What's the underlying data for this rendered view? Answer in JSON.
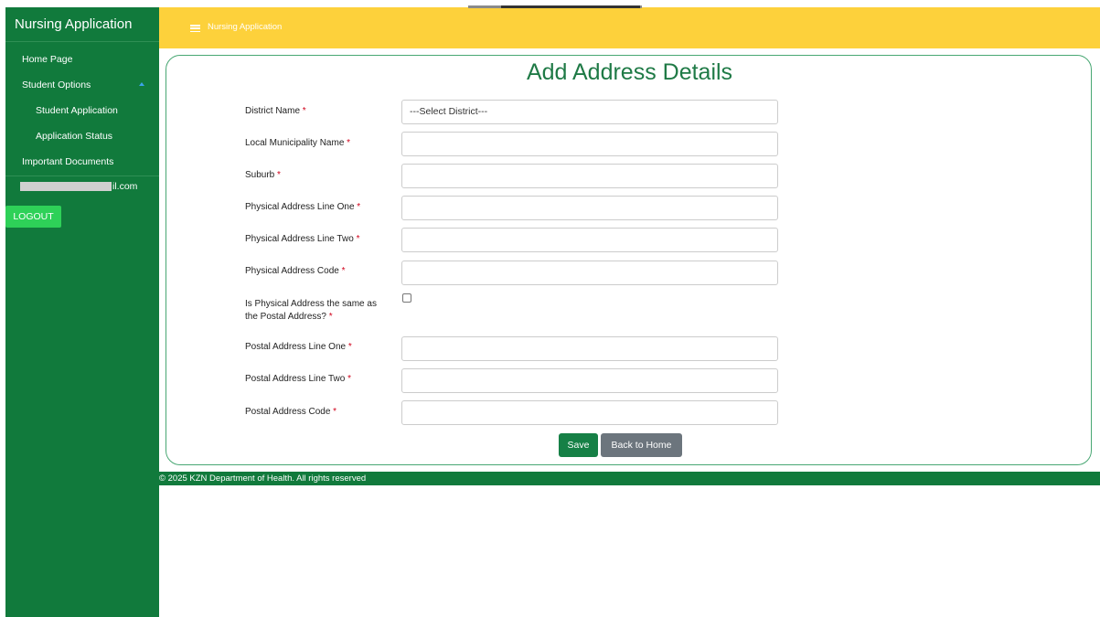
{
  "sidebar": {
    "brand": "Nursing Application",
    "items": [
      {
        "label": "Home Page"
      },
      {
        "label": "Student Options"
      },
      {
        "label": "Student Application"
      },
      {
        "label": "Application Status"
      },
      {
        "label": "Important Documents"
      }
    ],
    "user_email_suffix": "il.com",
    "logout_label": "LOGOUT"
  },
  "topbar": {
    "title": "Nursing Application",
    "menu_icon": "hamburger-icon"
  },
  "form": {
    "title": "Add Address Details",
    "fields": [
      {
        "label": "District Name",
        "value": "---Select District---"
      },
      {
        "label": "Local Municipality Name",
        "value": ""
      },
      {
        "label": "Suburb",
        "value": ""
      },
      {
        "label": "Physical Address Line One",
        "value": ""
      },
      {
        "label": "Physical Address Line Two",
        "value": ""
      },
      {
        "label": "Physical Address Code",
        "value": ""
      },
      {
        "label_line1": "Is Physical Address the same as",
        "label_line2": "the Postal Address?"
      },
      {
        "label": "Postal Address Line One",
        "value": ""
      },
      {
        "label": "Postal Address Line Two",
        "value": ""
      },
      {
        "label": "Postal Address Code",
        "value": ""
      }
    ],
    "required_marker": "*",
    "save_label": "Save",
    "back_label": "Back to Home"
  },
  "footer": {
    "text": "© 2025 KZN Department of Health. All rights reserved"
  },
  "colors": {
    "sidebar_green": "#117a3c",
    "topbar_yellow": "#fdd13b",
    "title_green": "#1f7a46",
    "required_red": "#d0021b",
    "logout_green": "#2ed158",
    "back_gray": "#6c757d"
  }
}
